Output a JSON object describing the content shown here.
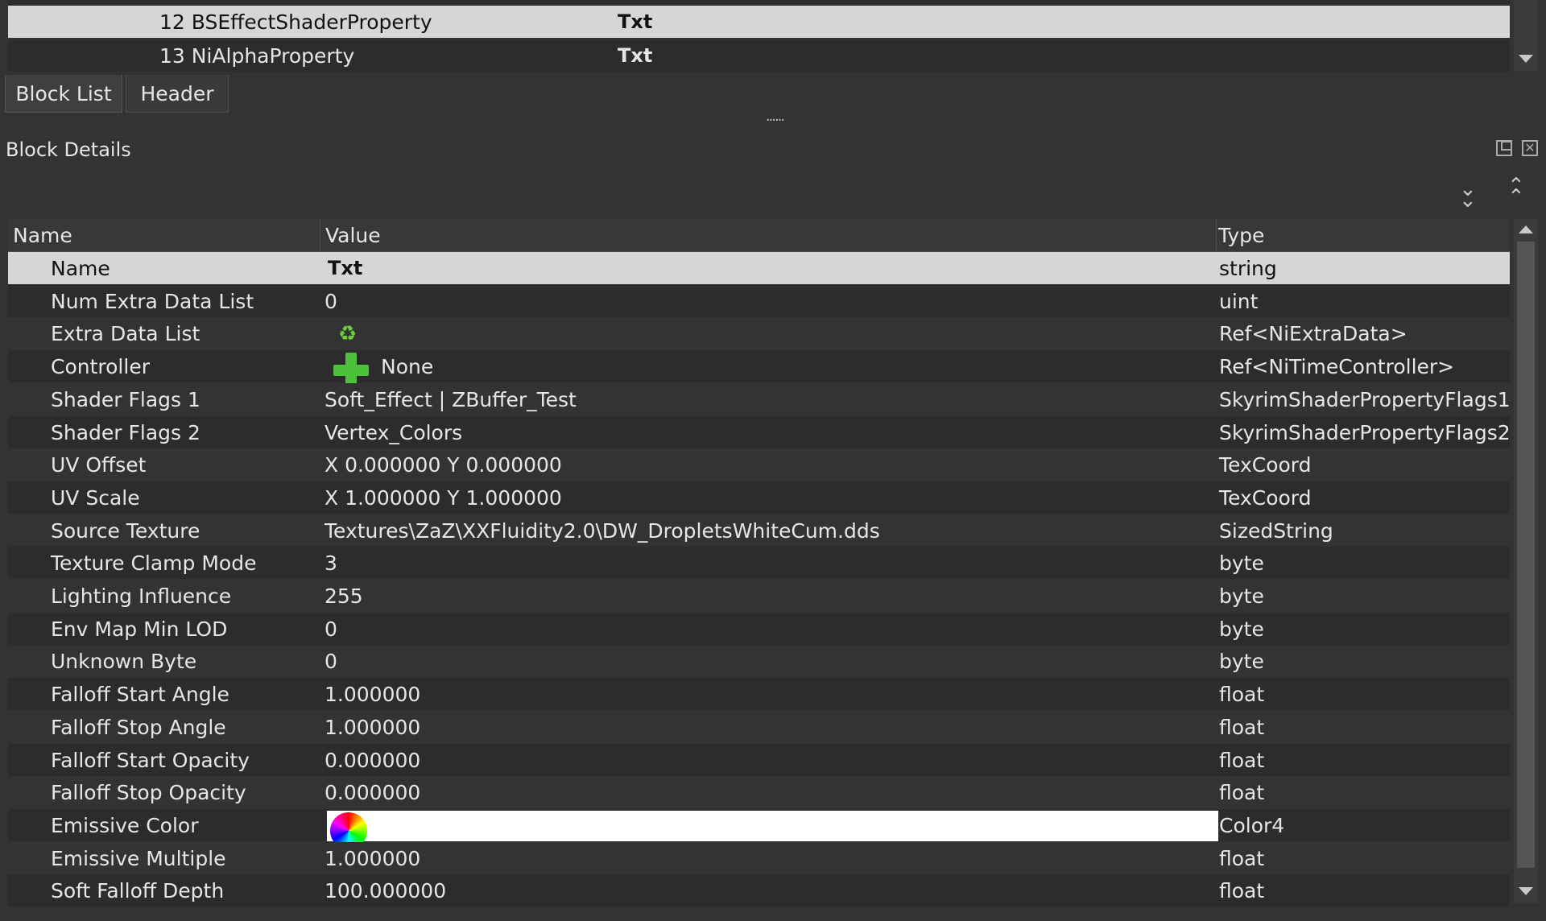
{
  "block_list": {
    "rows": [
      {
        "name": "12 BSEffectShaderProperty",
        "value": "Txt",
        "selected": true
      },
      {
        "name": "13 NiAlphaProperty",
        "value": "Txt",
        "selected": false
      }
    ],
    "tabs": [
      {
        "label": "Block List",
        "active": true
      },
      {
        "label": "Header",
        "active": false
      }
    ]
  },
  "splitter": {
    "glyph": "......"
  },
  "block_details": {
    "title": "Block Details",
    "columns": {
      "name": "Name",
      "value": "Value",
      "type": "Type"
    },
    "rows": [
      {
        "name": "Name",
        "value": "Txt",
        "type": "string"
      },
      {
        "name": "Num Extra Data List",
        "value": "0",
        "type": "uint"
      },
      {
        "name": "Extra Data List",
        "value": "",
        "type": "Ref<NiExtraData>"
      },
      {
        "name": "Controller",
        "value": "None",
        "type": "Ref<NiTimeController>"
      },
      {
        "name": "Shader Flags 1",
        "value": "Soft_Effect | ZBuffer_Test",
        "type": "SkyrimShaderPropertyFlags1"
      },
      {
        "name": "Shader Flags 2",
        "value": "Vertex_Colors",
        "type": "SkyrimShaderPropertyFlags2"
      },
      {
        "name": "UV Offset",
        "value": "X 0.000000 Y 0.000000",
        "type": "TexCoord"
      },
      {
        "name": "UV Scale",
        "value": "X 1.000000 Y 1.000000",
        "type": "TexCoord"
      },
      {
        "name": "Source Texture",
        "value": "Textures\\ZaZ\\XXFluidity2.0\\DW_DropletsWhiteCum.dds",
        "type": "SizedString"
      },
      {
        "name": "Texture Clamp Mode",
        "value": "3",
        "type": "byte"
      },
      {
        "name": "Lighting Influence",
        "value": "255",
        "type": "byte"
      },
      {
        "name": "Env Map Min LOD",
        "value": "0",
        "type": "byte"
      },
      {
        "name": "Unknown Byte",
        "value": "0",
        "type": "byte"
      },
      {
        "name": "Falloff Start Angle",
        "value": "1.000000",
        "type": "float"
      },
      {
        "name": "Falloff Stop Angle",
        "value": "1.000000",
        "type": "float"
      },
      {
        "name": "Falloff Start Opacity",
        "value": "0.000000",
        "type": "float"
      },
      {
        "name": "Falloff Stop Opacity",
        "value": "0.000000",
        "type": "float"
      },
      {
        "name": "Emissive Color",
        "value": "",
        "type": "Color4"
      },
      {
        "name": "Emissive Multiple",
        "value": "1.000000",
        "type": "float"
      },
      {
        "name": "Soft Falloff Depth",
        "value": "100.000000",
        "type": "float"
      }
    ]
  },
  "icons": {
    "controller": "plus-icon",
    "extra_data": "refresh-icon",
    "emissive_color": "color-wheel-icon",
    "expand_all": "double-chevron-down-icon",
    "collapse_all": "double-chevron-up-icon",
    "float_panel": "float-window-icon",
    "close_panel": "close-icon"
  },
  "colors": {
    "background": "#333333",
    "selected_row": "#d6d6d6",
    "alt_row": "#2c2c2c",
    "emissive_color": "#ffffff",
    "plus_green": "#4cc23a"
  }
}
